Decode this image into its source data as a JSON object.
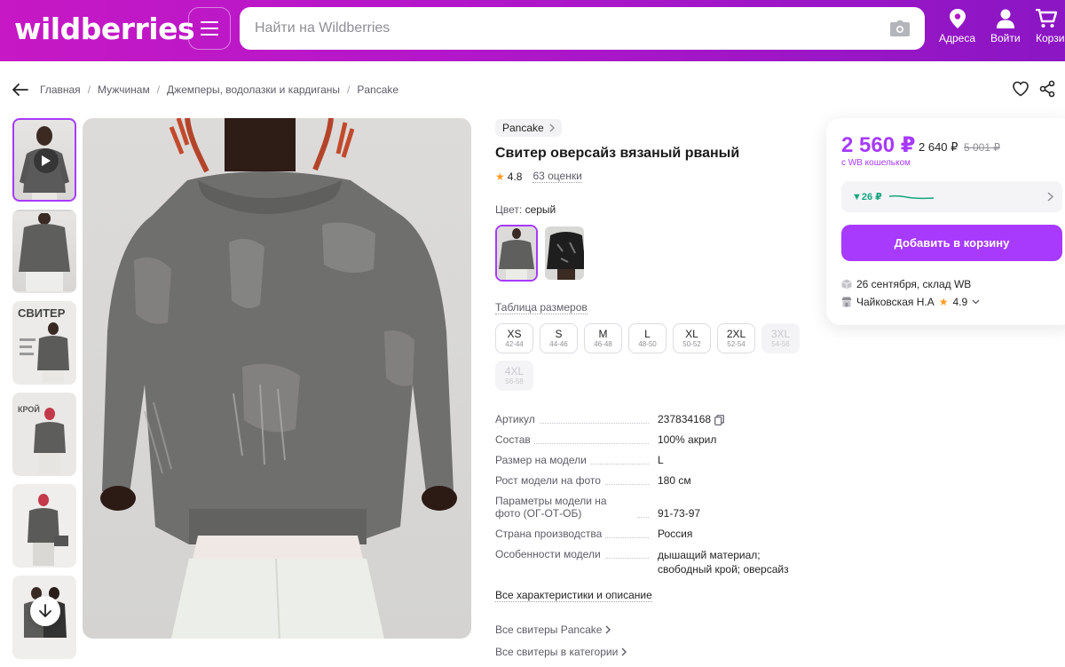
{
  "header": {
    "logo": "wildberries",
    "search_placeholder": "Найти на Wildberries",
    "nav": [
      {
        "label": "Адреса",
        "icon": "location-pin-icon"
      },
      {
        "label": "Войти",
        "icon": "user-icon"
      },
      {
        "label": "Корзина",
        "icon": "cart-icon"
      }
    ]
  },
  "breadcrumbs": [
    "Главная",
    "Мужчинам",
    "Джемперы, водолазки и кардиганы",
    "Pancake"
  ],
  "thumbnails": {
    "title_3": "СВИТЕР",
    "title_4": "КРОЙ"
  },
  "product": {
    "brand": "Pancake",
    "title": "Свитер оверсайз вязаный рваный",
    "rating": "4.8",
    "reviews": "63 оценки",
    "color_label": "Цвет:",
    "color_value": "серый",
    "size_table_link": "Таблица размеров",
    "sizes": [
      {
        "size": "XS",
        "ru": "42-44",
        "available": true
      },
      {
        "size": "S",
        "ru": "44-46",
        "available": true
      },
      {
        "size": "M",
        "ru": "46-48",
        "available": true
      },
      {
        "size": "L",
        "ru": "48-50",
        "available": true
      },
      {
        "size": "XL",
        "ru": "50-52",
        "available": true
      },
      {
        "size": "2XL",
        "ru": "52-54",
        "available": true
      },
      {
        "size": "3XL",
        "ru": "54-56",
        "available": false
      },
      {
        "size": "4XL",
        "ru": "56-58",
        "available": false
      }
    ],
    "specs": [
      {
        "key": "Артикул",
        "value": "237834168",
        "copy": true
      },
      {
        "key": "Состав",
        "value": "100% акрил"
      },
      {
        "key": "Размер на модели",
        "value": "L"
      },
      {
        "key": "Рост модели на фото",
        "value": "180 см"
      },
      {
        "key": "Параметры модели на фото (ОГ-ОТ-ОБ)",
        "value": "91-73-97"
      },
      {
        "key": "Страна производства",
        "value": "Россия"
      },
      {
        "key": "Особенности модели",
        "value": "дышащий материал; свободный крой; оверсайз"
      }
    ],
    "all_chars_link": "Все характеристики и описание",
    "more_links": [
      "Все свитеры Pancake",
      "Все свитеры в категории"
    ]
  },
  "buy_box": {
    "price": "2 560 ₽",
    "price_regular": "2 640 ₽",
    "price_old": "5 001 ₽",
    "wallet_note": "с WB кошельком",
    "price_drop": "▼26 ₽",
    "add_to_cart": "Добавить в корзину",
    "delivery": "26 сентября, склад WB",
    "seller": "Чайковская Н.А",
    "seller_rating": "4.9"
  },
  "colors": {
    "brand_gradient_start": "#c618c4",
    "brand_gradient_end": "#8b16c4",
    "accent": "#a73afd",
    "price_drop": "#14a57e",
    "rating_star": "#ff9b22"
  }
}
